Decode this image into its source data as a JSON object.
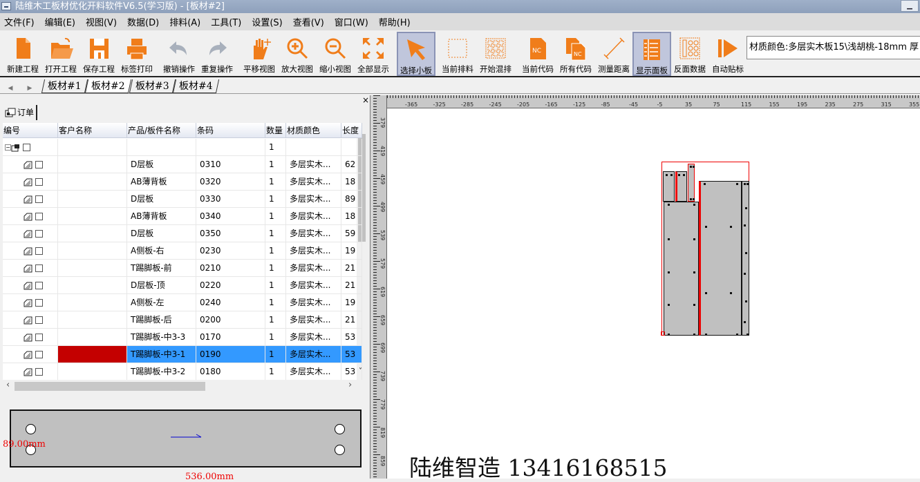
{
  "window": {
    "title": "陆维木工板材优化开料软件V6.5(学习版) - [板材#2]",
    "minimize": "▁"
  },
  "menu": [
    "文件(F)",
    "编辑(E)",
    "视图(V)",
    "数据(D)",
    "排料(A)",
    "工具(T)",
    "设置(S)",
    "查看(V)",
    "窗口(W)",
    "帮助(H)"
  ],
  "toolbar": [
    {
      "label": "新建工程",
      "icon": "new-file-icon",
      "selected": false
    },
    {
      "label": "打开工程",
      "icon": "open-folder-icon",
      "selected": false
    },
    {
      "label": "保存工程",
      "icon": "save-icon",
      "selected": false
    },
    {
      "label": "标签打印",
      "icon": "print-icon",
      "selected": false
    },
    {
      "label": "撤销操作",
      "icon": "undo-icon",
      "selected": false
    },
    {
      "label": "重复操作",
      "icon": "redo-icon",
      "selected": false
    },
    {
      "label": "平移视图",
      "icon": "pan-hand-icon",
      "selected": false
    },
    {
      "label": "放大视图",
      "icon": "zoom-in-icon",
      "selected": false
    },
    {
      "label": "缩小视图",
      "icon": "zoom-out-icon",
      "selected": false
    },
    {
      "label": "全部显示",
      "icon": "fit-all-icon",
      "selected": false
    },
    {
      "label": "选择小板",
      "icon": "select-arrow-icon",
      "selected": true
    },
    {
      "label": "当前排料",
      "icon": "current-nesting-icon",
      "selected": false
    },
    {
      "label": "开始混排",
      "icon": "mixed-nesting-icon",
      "selected": false
    },
    {
      "label": "当前代码",
      "icon": "nc-code-icon",
      "selected": false
    },
    {
      "label": "所有代码",
      "icon": "nc-all-codes-icon",
      "selected": false
    },
    {
      "label": "测量距离",
      "icon": "measure-icon",
      "selected": false
    },
    {
      "label": "显示面板",
      "icon": "show-panel-icon",
      "selected": true
    },
    {
      "label": "反面数据",
      "icon": "back-side-icon",
      "selected": false
    },
    {
      "label": "自动贴标",
      "icon": "auto-label-icon",
      "selected": false
    }
  ],
  "material_field": "材质颜色:多层实木板15\\浅胡桃-18mm 厚",
  "sheet_tabs": [
    {
      "label": "板材#1",
      "active": false
    },
    {
      "label": "板材#2",
      "active": true
    },
    {
      "label": "板材#3",
      "active": false
    },
    {
      "label": "板材#4",
      "active": false
    }
  ],
  "nav": {
    "prev": "◀",
    "next": "▶"
  },
  "order_panel": {
    "tab": "订单",
    "close": "×",
    "columns": [
      "编号",
      "客户名称",
      "产品/板件名称",
      "条码",
      "数量",
      "材质颜色",
      "长度"
    ],
    "group_row": {
      "qty": "1"
    },
    "rows": [
      {
        "name": "D层板",
        "code": "0310",
        "qty": "1",
        "material": "多层实木...",
        "length": "62"
      },
      {
        "name": "AB薄背板",
        "code": "0320",
        "qty": "1",
        "material": "多层实木...",
        "length": "18"
      },
      {
        "name": "D层板",
        "code": "0330",
        "qty": "1",
        "material": "多层实木...",
        "length": "89"
      },
      {
        "name": "AB薄背板",
        "code": "0340",
        "qty": "1",
        "material": "多层实木...",
        "length": "18"
      },
      {
        "name": "D层板",
        "code": "0350",
        "qty": "1",
        "material": "多层实木...",
        "length": "59"
      },
      {
        "name": "A侧板-右",
        "code": "0230",
        "qty": "1",
        "material": "多层实木...",
        "length": "19"
      },
      {
        "name": "T踢脚板-前",
        "code": "0210",
        "qty": "1",
        "material": "多层实木...",
        "length": "21"
      },
      {
        "name": "D层板-顶",
        "code": "0220",
        "qty": "1",
        "material": "多层实木...",
        "length": "21"
      },
      {
        "name": "A侧板-左",
        "code": "0240",
        "qty": "1",
        "material": "多层实木...",
        "length": "19"
      },
      {
        "name": "T踢脚板-后",
        "code": "0200",
        "qty": "1",
        "material": "多层实木...",
        "length": "21"
      },
      {
        "name": "T踢脚板-中3-3",
        "code": "0170",
        "qty": "1",
        "material": "多层实木...",
        "length": "53"
      },
      {
        "name": "T踢脚板-中3-1",
        "code": "0190",
        "qty": "1",
        "material": "多层实木...",
        "length": "53",
        "selected": true
      },
      {
        "name": "T踢脚板-中3-2",
        "code": "0180",
        "qty": "1",
        "material": "多层实木...",
        "length": "53"
      }
    ]
  },
  "preview": {
    "height_label": "89.00mm",
    "width_label": "536.00mm"
  },
  "ruler": {
    "h_labels": [
      "-365",
      "-325",
      "-285",
      "-245",
      "-205",
      "-165",
      "-125",
      "-85",
      "-45",
      "-5",
      "35",
      "75",
      "115",
      "155",
      "195",
      "235",
      "275",
      "315",
      "355"
    ],
    "v_labels": [
      "379",
      "419",
      "459",
      "499",
      "539",
      "579",
      "619",
      "659",
      "699",
      "739",
      "779",
      "819",
      "859"
    ]
  },
  "watermark": "陆维智造 13416168515",
  "colors": {
    "accent": "#f07d1a",
    "selection": "#3399ff",
    "customer_highlight": "#c40000",
    "cut_red": "#e00000"
  }
}
